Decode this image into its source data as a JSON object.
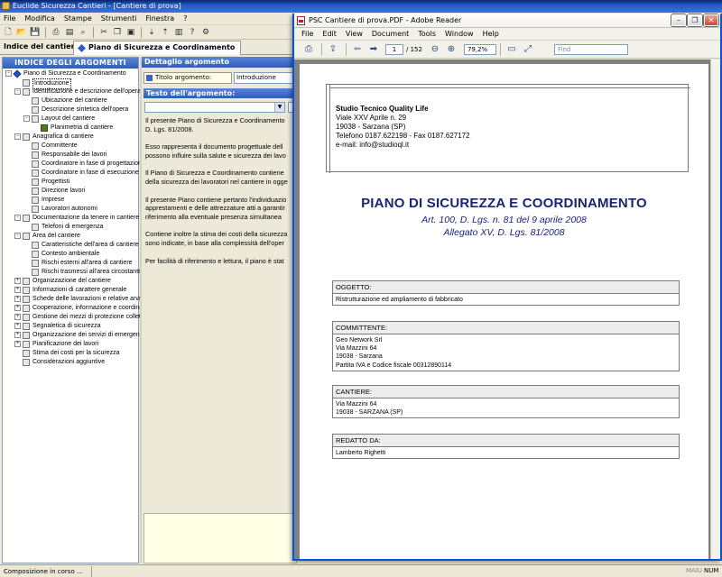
{
  "app": {
    "title": "Euclide Sicurezza Cantieri - [Cantiere di prova]",
    "menu": [
      "File",
      "Modifica",
      "Stampe",
      "Strumenti",
      "Finestra",
      "?"
    ],
    "toolbar_icons": [
      "new-icon",
      "open-icon",
      "save-icon",
      "print-icon",
      "preview-icon",
      "find-icon",
      "cut-icon",
      "copy-icon",
      "paste-icon",
      "move-down-icon",
      "move-up-icon",
      "book-icon",
      "help-icon",
      "settings-icon"
    ],
    "tabs_label": "Indice del cantiere",
    "active_tab": "Piano di Sicurezza e Coordinamento"
  },
  "left_panel": {
    "title": "INDICE DEGLI ARGOMENTI",
    "tree": [
      {
        "label": "Piano di Sicurezza e Coordinamento",
        "level": 0,
        "expander": "-",
        "icon": "root"
      },
      {
        "label": "Introduzione",
        "level": 1,
        "expander": "",
        "icon": "doc",
        "selected": true
      },
      {
        "label": "Identificazione e descrizione dell'opera",
        "level": 1,
        "expander": "-",
        "icon": "doc"
      },
      {
        "label": "Ubicazione del cantiere",
        "level": 2,
        "expander": "",
        "icon": "doc"
      },
      {
        "label": "Descrizione sintetica dell'opera",
        "level": 2,
        "expander": "",
        "icon": "doc"
      },
      {
        "label": "Layout del cantiere",
        "level": 2,
        "expander": "-",
        "icon": "doc"
      },
      {
        "label": "Planimetria di cantiere",
        "level": 3,
        "expander": "",
        "icon": "bld"
      },
      {
        "label": "Anagrafica di cantiere",
        "level": 1,
        "expander": "-",
        "icon": "doc"
      },
      {
        "label": "Committente",
        "level": 2,
        "expander": "",
        "icon": "doc"
      },
      {
        "label": "Responsabile dei lavori",
        "level": 2,
        "expander": "",
        "icon": "doc"
      },
      {
        "label": "Coordinatore in fase di progettazione",
        "level": 2,
        "expander": "",
        "icon": "doc"
      },
      {
        "label": "Coordinatore in fase di esecuzione",
        "level": 2,
        "expander": "",
        "icon": "doc"
      },
      {
        "label": "Progettisti",
        "level": 2,
        "expander": "",
        "icon": "doc"
      },
      {
        "label": "Direzione lavori",
        "level": 2,
        "expander": "",
        "icon": "doc"
      },
      {
        "label": "Imprese",
        "level": 2,
        "expander": "",
        "icon": "doc"
      },
      {
        "label": "Lavoratori autonomi",
        "level": 2,
        "expander": "",
        "icon": "doc"
      },
      {
        "label": "Documentazione da tenere in cantiere",
        "level": 1,
        "expander": "-",
        "icon": "doc"
      },
      {
        "label": "Telefoni di emergenza",
        "level": 2,
        "expander": "",
        "icon": "doc"
      },
      {
        "label": "Area del cantiere",
        "level": 1,
        "expander": "-",
        "icon": "doc"
      },
      {
        "label": "Caratteristiche dell'area di cantiere",
        "level": 2,
        "expander": "",
        "icon": "doc"
      },
      {
        "label": "Contesto ambientale",
        "level": 2,
        "expander": "",
        "icon": "doc"
      },
      {
        "label": "Rischi esterni all'area di cantiere",
        "level": 2,
        "expander": "",
        "icon": "doc"
      },
      {
        "label": "Rischi trasmessi all'area circostante",
        "level": 2,
        "expander": "",
        "icon": "doc"
      },
      {
        "label": "Organizzazione del cantiere",
        "level": 1,
        "expander": "+",
        "icon": "doc"
      },
      {
        "label": "Informazioni di carattere generale",
        "level": 1,
        "expander": "+",
        "icon": "doc"
      },
      {
        "label": "Schede delle lavorazioni e relative anal",
        "level": 1,
        "expander": "+",
        "icon": "doc"
      },
      {
        "label": "Cooperazione, informazione e coordinar",
        "level": 1,
        "expander": "+",
        "icon": "doc"
      },
      {
        "label": "Gestione dei mezzi di protezione collett",
        "level": 1,
        "expander": "+",
        "icon": "doc"
      },
      {
        "label": "Segnaletica di sicurezza",
        "level": 1,
        "expander": "+",
        "icon": "doc"
      },
      {
        "label": "Organizzazione dei servizi di emergenza",
        "level": 1,
        "expander": "+",
        "icon": "doc"
      },
      {
        "label": "Pianificazione dei lavori",
        "level": 1,
        "expander": "+",
        "icon": "doc"
      },
      {
        "label": "Stima dei costi per la sicurezza",
        "level": 1,
        "expander": "",
        "icon": "doc"
      },
      {
        "label": "Considerazioni aggiuntive",
        "level": 1,
        "expander": "",
        "icon": "doc"
      }
    ]
  },
  "detail_panel": {
    "title": "Dettaglio argomento",
    "field_label": "Titolo argomento:",
    "field_value": "Introduzione",
    "text_header": "Testo dell'argomento:",
    "paragraphs": [
      "Il presente Piano di Sicurezza e Coordinamento",
      "D. Lgs. 81/2008.",
      "Esso rappresenta il documento progettuale dell",
      "possono influire sulla salute e sicurezza dei lavo",
      "Il Piano di Sicurezza e Coordinamento contiene",
      "della sicurezza dei lavoratori nel cantiere in ogge",
      "Il presente Piano contiene pertanto l'individuazio",
      "apprestamenti e delle attrezzature atti a garantir",
      "riferimento alla eventuale presenza simultanea",
      "Contiene inoltre la stima dei costi della sicurezza",
      "sono indicate, in base alla complessità dell'oper",
      "Per facilità di riferimento e lettura, il piano è stat"
    ]
  },
  "status": {
    "text": "Composizione in corso ...",
    "maiu": "MAIU",
    "num": "NUM"
  },
  "reader": {
    "title": "PSC Cantiere di prova.PDF - Adobe Reader",
    "menu": [
      "File",
      "Edit",
      "View",
      "Document",
      "Tools",
      "Window",
      "Help"
    ],
    "page_current": "1",
    "page_total": "/ 152",
    "zoom": "79,2%",
    "find_placeholder": "Find",
    "document": {
      "company_name": "Studio Tecnico Quality Life",
      "company_lines": [
        "Viale XXV Aprile n. 29",
        "19038 - Sarzana (SP)",
        "Telefono 0187.622198 - Fax 0187.627172",
        "e-mail: info@studioql.it"
      ],
      "title": "PIANO DI SICUREZZA E COORDINAMENTO",
      "subtitle1": "Art. 100, D. Lgs. n. 81 del 9 aprile 2008",
      "subtitle2": "Allegato XV, D. Lgs. 81/2008",
      "sections": [
        {
          "header": "OGGETTO:",
          "lines": [
            "Ristrutturazione ed ampliamento di fabbricato"
          ]
        },
        {
          "header": "COMMITTENTE:",
          "lines": [
            "Geo Network Srl",
            "Via Mazzini 64",
            "19038 - Sarzana",
            "Partita IVA e Codice fiscale 00312890114"
          ]
        },
        {
          "header": "CANTIERE:",
          "lines": [
            "Via Mazzini 64",
            "19038 - SARZANA (SP)"
          ]
        },
        {
          "header": "REDATTO DA:",
          "lines": [
            "Lamberto Righetti"
          ]
        }
      ]
    }
  }
}
